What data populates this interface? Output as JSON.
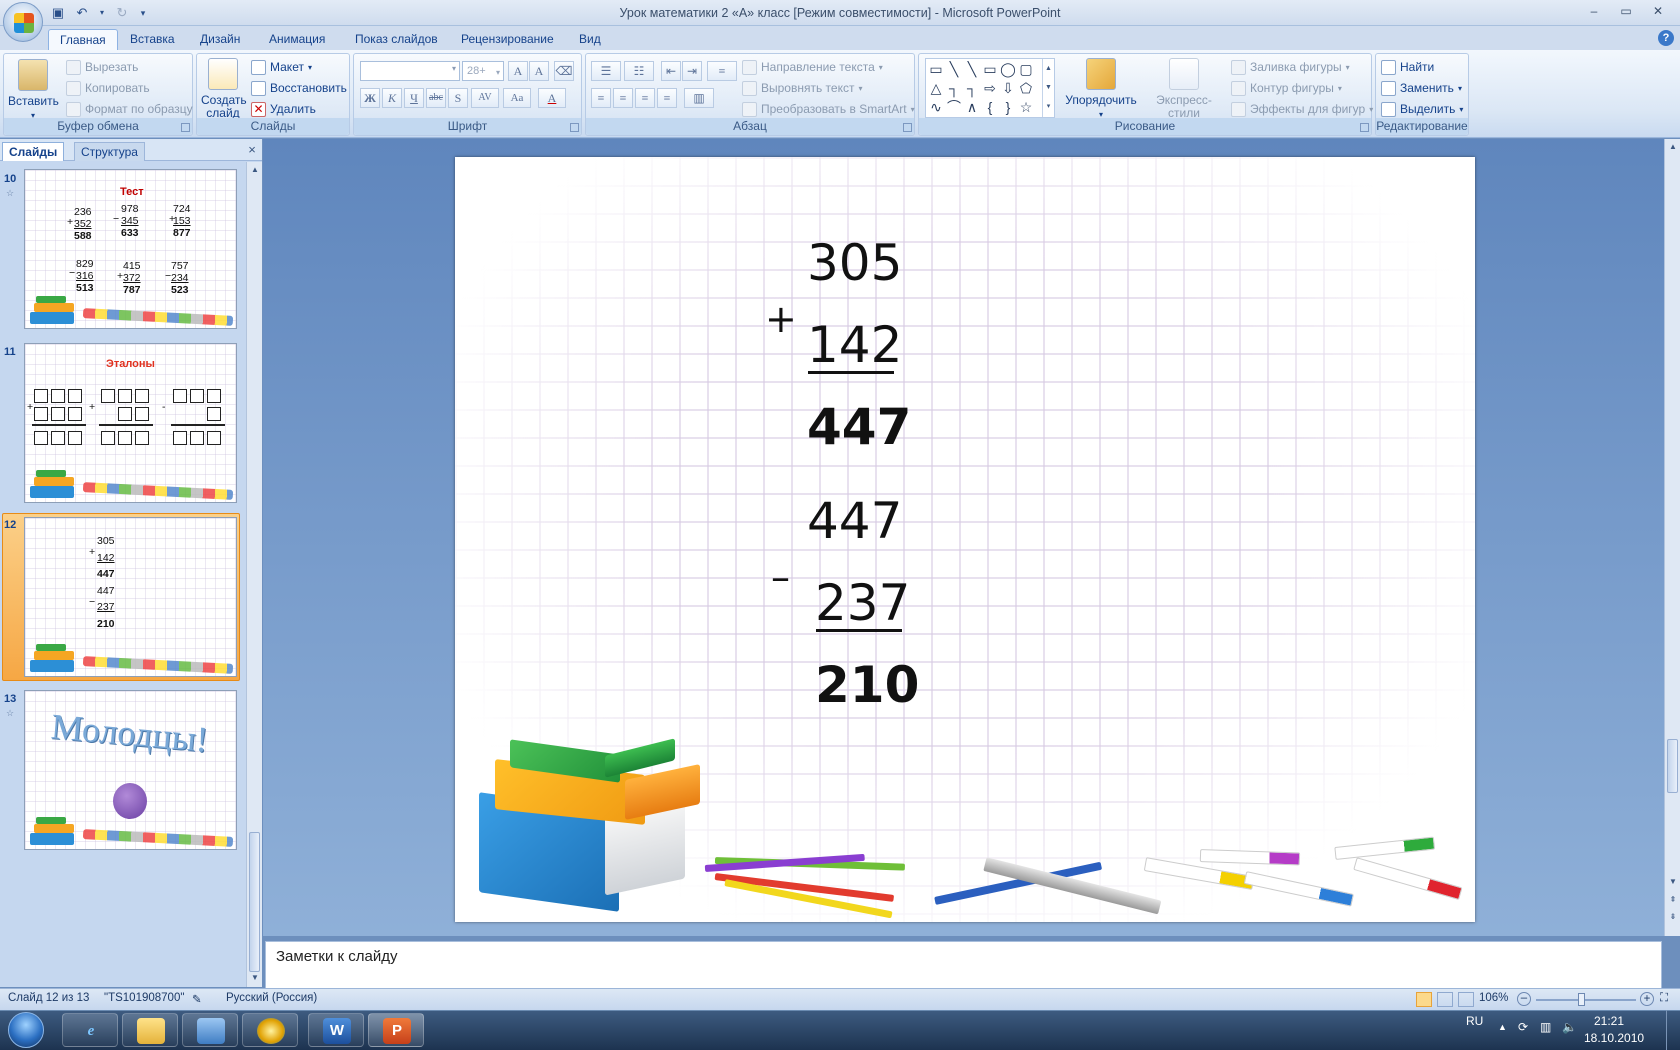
{
  "window": {
    "title": "Урок математики 2 «А» класс [Режим совместимости] - Microsoft PowerPoint",
    "controls": [
      "–",
      "▭",
      "✕"
    ]
  },
  "tabs": [
    "Главная",
    "Вставка",
    "Дизайн",
    "Анимация",
    "Показ слайдов",
    "Рецензирование",
    "Вид"
  ],
  "ribbon": {
    "clipboard": {
      "label": "Буфер обмена",
      "paste": "Вставить",
      "cut": "Вырезать",
      "copy": "Копировать",
      "format": "Формат по образцу"
    },
    "slides": {
      "label": "Слайды",
      "new_slide": "Создать слайд",
      "layout": "Макет",
      "reset": "Восстановить",
      "delete": "Удалить"
    },
    "font": {
      "label": "Шрифт",
      "size": "28+"
    },
    "paragraph": {
      "label": "Абзац",
      "direction": "Направление текста",
      "align_text": "Выровнять текст",
      "smartart": "Преобразовать в SmartArt"
    },
    "drawing": {
      "label": "Рисование",
      "arrange": "Упорядочить",
      "quick_styles": "Экспресс-стили",
      "fill": "Заливка фигуры",
      "outline": "Контур фигуры",
      "effects": "Эффекты для фигур"
    },
    "editing": {
      "label": "Редактирование",
      "find": "Найти",
      "replace": "Заменить",
      "select": "Выделить"
    }
  },
  "left_pane": {
    "tab_slides": "Слайды",
    "tab_structure": "Структура",
    "close": "×",
    "slides": [
      {
        "number": "10",
        "title": "Тест",
        "selected": false
      },
      {
        "number": "11",
        "title": "Эталоны",
        "selected": false
      },
      {
        "number": "12",
        "title": "",
        "selected": true
      },
      {
        "number": "13",
        "title": "Молодцы!",
        "selected": false
      }
    ],
    "thumb10": {
      "c1": [
        "236",
        "352",
        "588"
      ],
      "c2": [
        "978",
        "345",
        "633"
      ],
      "c3": [
        "724",
        "153",
        "877"
      ],
      "c4": [
        "829",
        "316",
        "513"
      ],
      "c5": [
        "415",
        "372",
        "787"
      ],
      "c6": [
        "757",
        "234",
        "523"
      ],
      "ops": [
        "+",
        "−",
        "+",
        "−",
        "+",
        "−"
      ]
    },
    "thumb11": {
      "ops": [
        "+",
        "+",
        "-"
      ]
    },
    "thumb12": {
      "lines": [
        "305",
        "142",
        "447",
        "447",
        "237",
        "210"
      ],
      "ops": [
        "+",
        "−"
      ]
    }
  },
  "slide": {
    "addition": {
      "a": "305",
      "b": "142",
      "result": "447",
      "op": "+"
    },
    "subtraction": {
      "a": "447",
      "b": "237",
      "result": "210",
      "op": "–"
    }
  },
  "notes": {
    "placeholder": "Заметки к слайду"
  },
  "status": {
    "slide_info": "Слайд 12 из 13",
    "theme": "\"TS101908700\"",
    "language": "Русский (Россия)",
    "zoom": "106%"
  },
  "taskbar": {
    "lang": "RU",
    "time": "21:21",
    "date": "18.10.2010"
  },
  "colors": {
    "accent": "#15428b",
    "selected_thumb": "#f6a744",
    "title_red": "#c00000"
  }
}
